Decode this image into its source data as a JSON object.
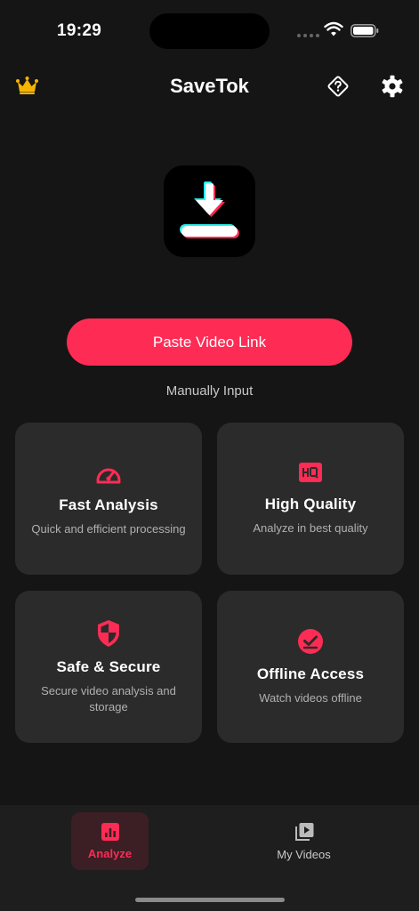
{
  "status_bar": {
    "time": "19:29"
  },
  "header": {
    "title": "SaveTok"
  },
  "main": {
    "paste_button_label": "Paste Video Link",
    "manual_input_label": "Manually Input"
  },
  "features": [
    {
      "title": "Fast Analysis",
      "description": "Quick and efficient processing",
      "icon": "speedometer-icon"
    },
    {
      "title": "High Quality",
      "description": "Analyze in best quality",
      "icon": "hq-icon"
    },
    {
      "title": "Safe & Secure",
      "description": "Secure video analysis and storage",
      "icon": "shield-icon"
    },
    {
      "title": "Offline Access",
      "description": "Watch videos offline",
      "icon": "offline-check-icon"
    }
  ],
  "tab_bar": {
    "tabs": [
      {
        "label": "Analyze",
        "icon": "chart-icon",
        "active": true
      },
      {
        "label": "My Videos",
        "icon": "video-library-icon",
        "active": false
      }
    ]
  },
  "colors": {
    "accent": "#fe2c55",
    "background": "#151515",
    "card": "#2b2b2b",
    "crown": "#f5b400"
  }
}
